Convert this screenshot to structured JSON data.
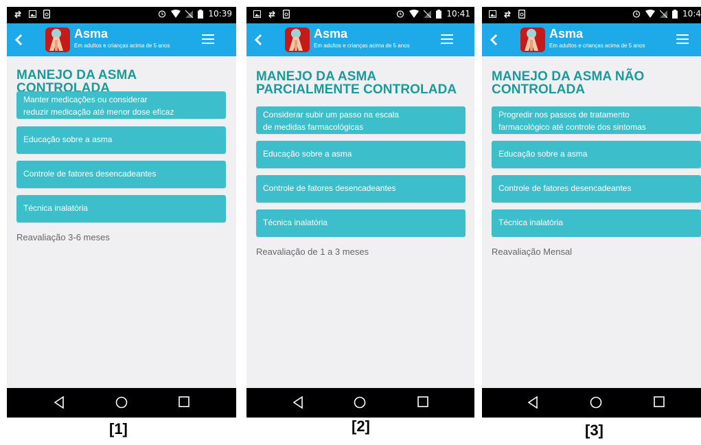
{
  "app": {
    "title": "Asma",
    "subtitle": "Em adultos e crianças acima de 5 anos"
  },
  "screens": [
    {
      "caption": "[1]",
      "time": "10:39",
      "heading_lines": [
        "MANEJO DA ASMA CONTROLADA"
      ],
      "cards": [
        {
          "lines": [
            "Manter medicações ou considerar",
            "reduzir medicação até menor dose eficaz"
          ]
        },
        {
          "lines": [
            "Educação sobre a asma"
          ]
        },
        {
          "lines": [
            "Controle de fatores desencadeantes"
          ]
        },
        {
          "lines": [
            "Técnica inalatória"
          ]
        }
      ],
      "reevaluation": "Reavaliação 3-6 meses"
    },
    {
      "caption": "[2]",
      "time": "10:41",
      "heading_lines": [
        "MANEJO DA ASMA",
        "PARCIALMENTE CONTROLADA"
      ],
      "cards": [
        {
          "lines": [
            "Considerar subir um passo na escala",
            "de medidas farmacológicas"
          ]
        },
        {
          "lines": [
            "Educação sobre a asma"
          ]
        },
        {
          "lines": [
            "Controle de fatores desencadeantes"
          ]
        },
        {
          "lines": [
            "Técnica inalatória"
          ]
        }
      ],
      "reevaluation": "Reavaliação de 1 a 3 meses"
    },
    {
      "caption": "[3]",
      "time": "10:4",
      "heading_lines": [
        "MANEJO DA ASMA NÃO",
        "CONTROLADA"
      ],
      "cards": [
        {
          "lines": [
            "Progredir nos passos de tratamento",
            "farmacológico até controle dos sintomas"
          ]
        },
        {
          "lines": [
            "Educação sobre a asma"
          ]
        },
        {
          "lines": [
            "Controle de fatores desencadeantes"
          ]
        },
        {
          "lines": [
            "Técnica inalatória"
          ]
        }
      ],
      "reevaluation": "Reavaliação Mensal"
    }
  ],
  "icons": {
    "status_left": [
      "signal-arrows-icon",
      "image-icon",
      "phone-sync-icon"
    ],
    "status_right": [
      "alarm-icon",
      "wifi-icon",
      "no-signal-icon",
      "battery-icon"
    ],
    "appbar": [
      "back-arrow-icon",
      "app-logo-icon",
      "menu-icon"
    ],
    "navbar": [
      "back-triangle-icon",
      "home-circle-icon",
      "recents-square-icon"
    ]
  },
  "colors": {
    "appbar": "#1ea9e8",
    "heading": "#1a9a9a",
    "card": "#3dbfcb",
    "screen_bg": "#f0f0f2"
  }
}
